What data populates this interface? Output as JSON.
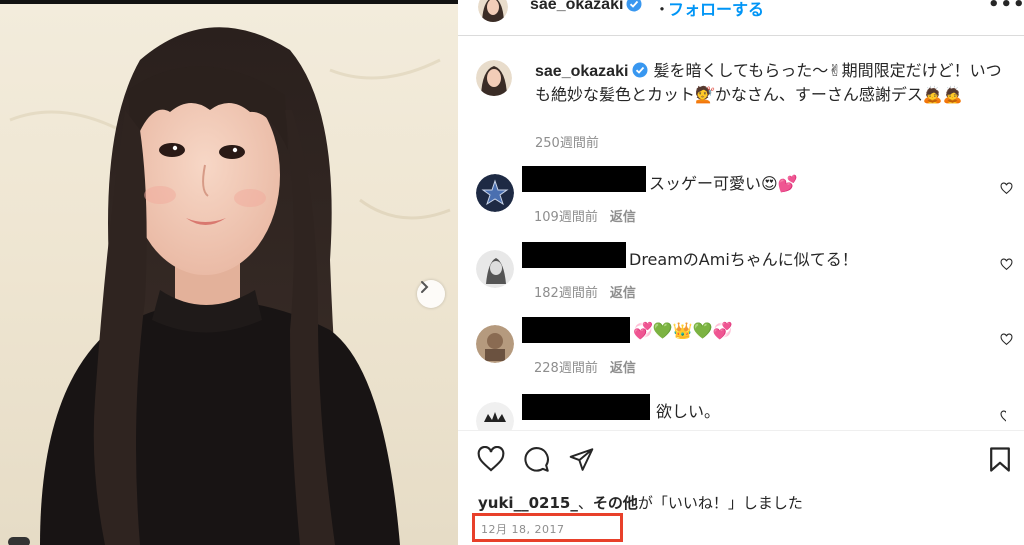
{
  "header": {
    "username": "sae_okazaki",
    "separator": "・",
    "follow_label": "フォローする",
    "more_label": "•••"
  },
  "caption": {
    "username": "sae_okazaki",
    "text": "髪を暗くしてもらった〜✌期間限定だけど！いつも絶妙な髪色とカット💇かなさん、すーさん感謝デス🙇🙇",
    "time": "250週間前"
  },
  "comments": [
    {
      "text": "スッゲー可愛い😍💕",
      "time": "109週間前",
      "reply": "返信"
    },
    {
      "text": "DreamのAmiちゃんに似てる！",
      "time": "182週間前",
      "reply": "返信"
    },
    {
      "text": "💞💚👑💚💞",
      "time": "228週間前",
      "reply": "返信"
    },
    {
      "text": "欲しい。",
      "time": "",
      "reply": ""
    }
  ],
  "likes": {
    "user": "yuki__0215_",
    "sep": "、",
    "others": "その他",
    "suffix": "が「いいね！」しました"
  },
  "date": "12月 18, 2017",
  "colors": {
    "accent": "#0095f6",
    "highlight_border": "#e8402a",
    "muted_text": "#8e8e8e",
    "verified": "#3897f0"
  },
  "icons": [
    "heart-icon",
    "comment-icon",
    "share-icon",
    "bookmark-icon",
    "verified-badge-icon",
    "next-arrow-icon",
    "more-icon"
  ]
}
